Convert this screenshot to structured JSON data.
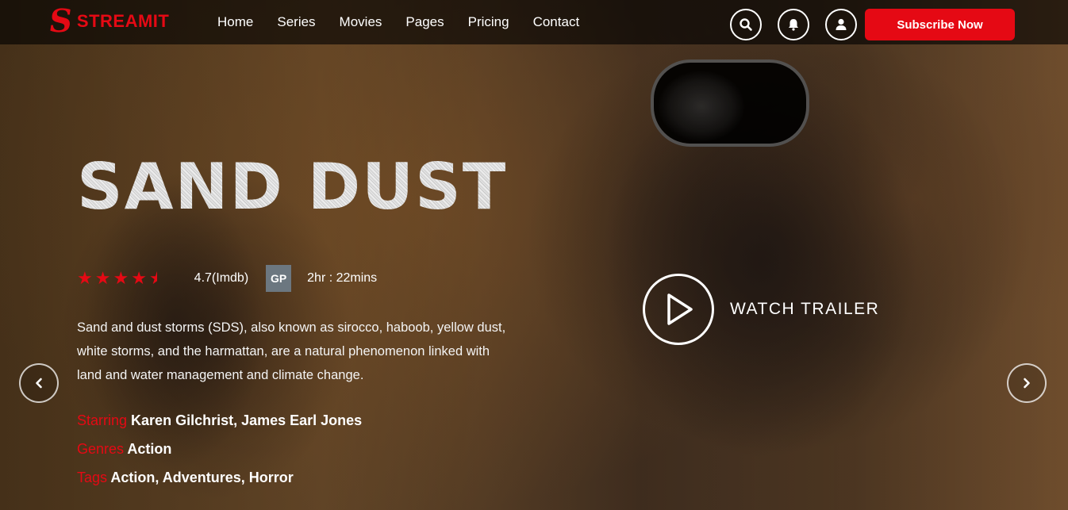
{
  "brand": {
    "mark": "S",
    "name": "STREAMIT"
  },
  "nav": {
    "items": [
      {
        "label": "Home"
      },
      {
        "label": "Series"
      },
      {
        "label": "Movies"
      },
      {
        "label": "Pages"
      },
      {
        "label": "Pricing"
      },
      {
        "label": "Contact"
      }
    ],
    "icons": [
      "search-icon",
      "bell-icon",
      "user-icon"
    ],
    "subscribe_label": "Subscribe Now"
  },
  "hero": {
    "title": "SAND DUST",
    "rating_stars": 4.5,
    "rating_text": "4.7(Imdb)",
    "badge": "GP",
    "runtime": "2hr : 22mins",
    "description": "Sand and dust storms (SDS), also known as sirocco, haboob, yellow dust, white storms, and the harmattan, are a natural phenomenon linked with land and water management and climate change.",
    "starring_label": "Starring",
    "starring_value": "Karen Gilchrist, James Earl Jones",
    "genres_label": "Genres",
    "genres_value": "Action",
    "tags_label": "Tags",
    "tags_value": "Action, Adventures, Horror",
    "trailer_label": "WATCH TRAILER"
  },
  "colors": {
    "accent": "#e50914",
    "badge": "#6c7780"
  }
}
